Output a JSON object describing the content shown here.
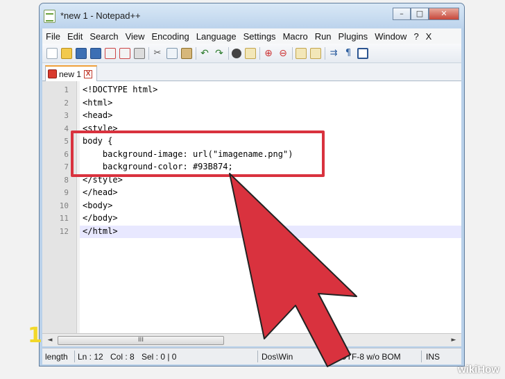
{
  "window": {
    "title": "*new  1 - Notepad++"
  },
  "menu": [
    "File",
    "Edit",
    "Search",
    "View",
    "Encoding",
    "Language",
    "Settings",
    "Macro",
    "Run",
    "Plugins",
    "Window",
    "?",
    "X"
  ],
  "tab": {
    "label": "new  1",
    "close": "X"
  },
  "editor": {
    "line_numbers": [
      "1",
      "2",
      "3",
      "4",
      "5",
      "6",
      "7",
      "8",
      "9",
      "10",
      "11",
      "12"
    ],
    "lines": [
      "<!DOCTYPE html>",
      "<html>",
      "<head>",
      "<style>",
      "body {",
      "    background-image: url(\"imagename.png\")",
      "    background-color: #93B874;",
      "</style>",
      "</head>",
      "<body>",
      "</body>",
      "</html>"
    ]
  },
  "scrollbar": {
    "left_arrow": "◄",
    "thumb_grip": "III",
    "right_arrow": "►"
  },
  "status": {
    "length": "length",
    "ln": "Ln : 12",
    "col": "Col : 8",
    "sel": "Sel : 0 | 0",
    "eol": "Dos\\Win",
    "encoding": "UTF-8 w/o BOM",
    "mode": "INS"
  },
  "overlay": {
    "step_number": "1",
    "watermark": "wikiHow",
    "highlight_color": "#d9323e",
    "arrow_color": "#d9323e"
  }
}
